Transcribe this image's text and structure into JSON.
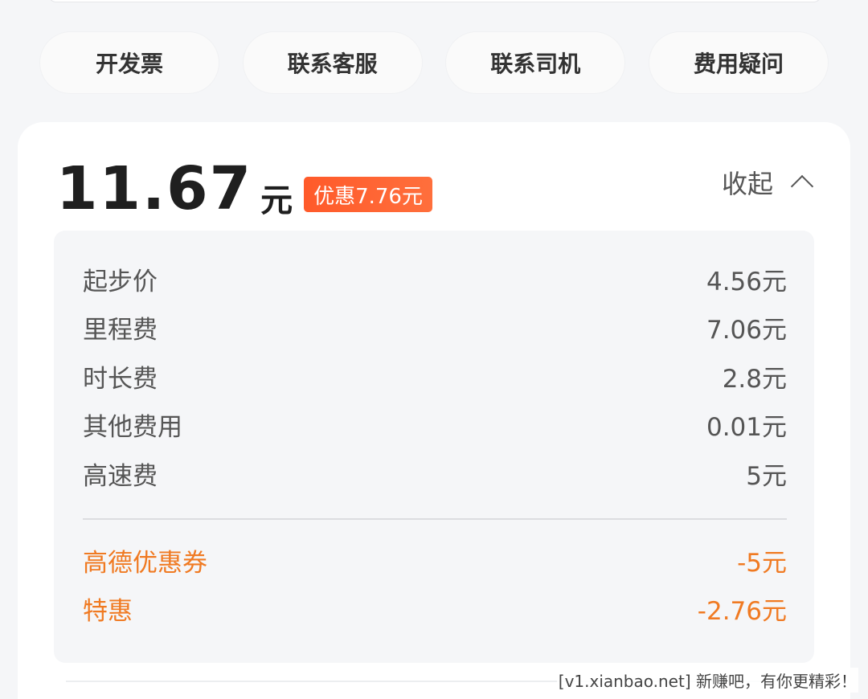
{
  "actions": [
    {
      "label": "开发票"
    },
    {
      "label": "联系客服"
    },
    {
      "label": "联系司机"
    },
    {
      "label": "费用疑问"
    }
  ],
  "summary": {
    "amount": "11.67",
    "unit": "元",
    "discount_badge": "优惠7.76元",
    "collapse_label": "收起"
  },
  "fees": [
    {
      "name": "起步价",
      "value": "4.56元"
    },
    {
      "name": "里程费",
      "value": "7.06元"
    },
    {
      "name": "时长费",
      "value": "2.8元"
    },
    {
      "name": "其他费用",
      "value": "0.01元"
    },
    {
      "name": "高速费",
      "value": "5元"
    }
  ],
  "discounts": [
    {
      "name": "高德优惠券",
      "value": "-5元"
    },
    {
      "name": "特惠",
      "value": "-2.76元"
    }
  ],
  "watermark": "[v1.xianbao.net] 新赚吧，有你更精彩！",
  "colors": {
    "discount_text": "#f07a22",
    "badge_bg": "#ff5a2a"
  }
}
